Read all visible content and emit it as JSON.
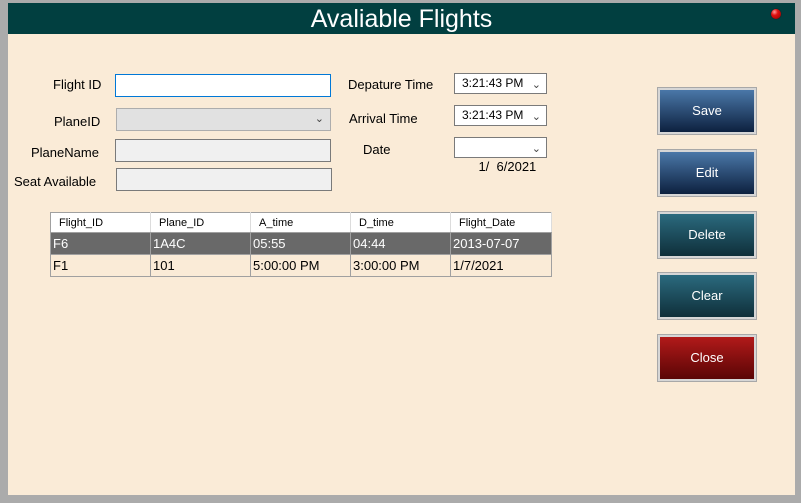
{
  "window": {
    "title": "Avaliable Flights",
    "status_indicator": "red-dot"
  },
  "form": {
    "flight_id": {
      "label": "Flight ID",
      "value": "",
      "placeholder": ""
    },
    "plane_id": {
      "label": "PlaneID",
      "value": ""
    },
    "plane_name": {
      "label": "PlaneName",
      "value": ""
    },
    "seat_available": {
      "label": "Seat Available",
      "value": ""
    },
    "departure_time": {
      "label": "Depature Time",
      "value": "3:21:43 PM"
    },
    "arrival_time": {
      "label": "Arrival Time",
      "value": "3:21:43 PM"
    },
    "date": {
      "label": "Date",
      "value": "1/  6/2021"
    }
  },
  "grid": {
    "columns": [
      "Flight_ID",
      "Plane_ID",
      "A_time",
      "D_time",
      "Flight_Date"
    ],
    "rows": [
      {
        "cells": [
          "F6",
          "1A4C",
          "05:55",
          "04:44",
          "2013-07-07"
        ],
        "selected": true
      },
      {
        "cells": [
          "F1",
          "101",
          "5:00:00 PM",
          "3:00:00 PM",
          "1/7/2021"
        ],
        "selected": false
      }
    ]
  },
  "buttons": {
    "save": "Save",
    "edit": "Edit",
    "delete": "Delete",
    "clear": "Clear",
    "close": "Close"
  },
  "colors": {
    "titlebar": "#013f40",
    "background": "#faebd7",
    "selected_row": "#696969",
    "save_edit": "#2a4f7f",
    "delete_clear": "#1d4d5c",
    "close": "#8a0f0f"
  }
}
